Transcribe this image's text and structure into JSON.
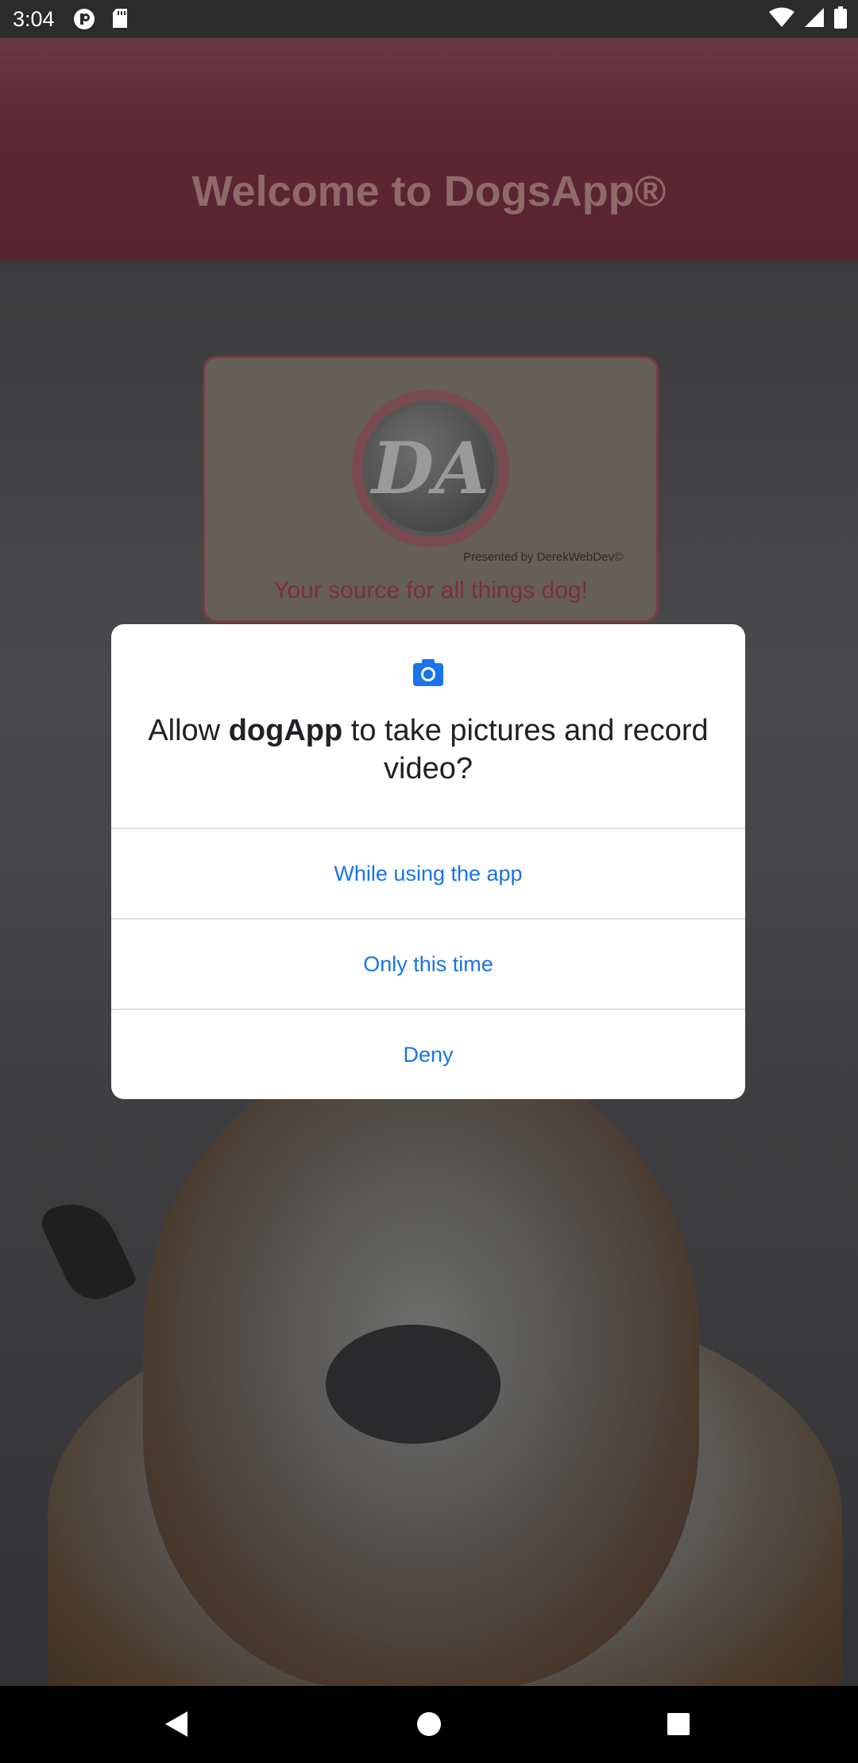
{
  "status_bar": {
    "time": "3:04",
    "left_icons": [
      "circle-p-icon",
      "sd-card-icon"
    ],
    "right_icons": [
      "wifi-icon",
      "cell-signal-icon",
      "battery-icon"
    ]
  },
  "app": {
    "title": "Welcome to DogsApp®",
    "logo_text": "DA",
    "presented_by": "Presented by DerekWebDev©",
    "tagline": "Your source for all things dog!"
  },
  "permission_dialog": {
    "icon": "camera-icon",
    "title_prefix": "Allow ",
    "app_name": "dogApp",
    "title_suffix": " to take pictures and record video?",
    "options": [
      {
        "label": "While using the app"
      },
      {
        "label": "Only this time"
      },
      {
        "label": "Deny"
      }
    ],
    "accent_color": "#1a73e8"
  },
  "nav_bar": {
    "buttons": [
      "back-icon",
      "home-icon",
      "recents-icon"
    ]
  }
}
